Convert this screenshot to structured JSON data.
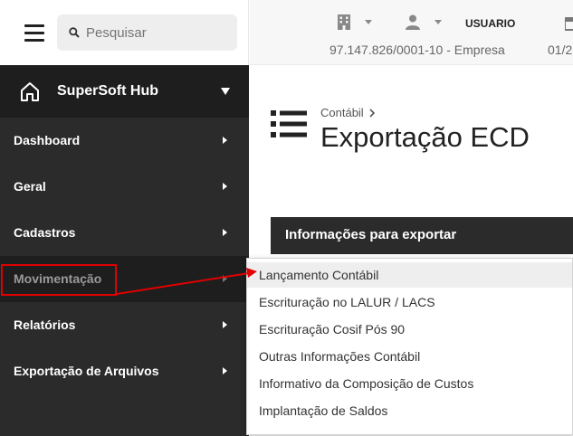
{
  "search": {
    "placeholder": "Pesquisar"
  },
  "header": {
    "user_label": "USUARIO",
    "company": "97.147.826/0001-10 - Empresa",
    "date_partial": "01/2"
  },
  "sidebar": {
    "hub_title": "SuperSoft Hub",
    "items": [
      {
        "label": "Dashboard"
      },
      {
        "label": "Geral"
      },
      {
        "label": "Cadastros"
      },
      {
        "label": "Movimentação"
      },
      {
        "label": "Relatórios"
      },
      {
        "label": "Exportação de Arquivos"
      }
    ]
  },
  "main": {
    "breadcrumb": "Contábil",
    "title": "Exportação ECD",
    "panel_header": "Informações para exportar"
  },
  "submenu": {
    "items": [
      {
        "label": "Lançamento Contábil"
      },
      {
        "label": "Escrituração no LALUR / LACS"
      },
      {
        "label": "Escrituração Cosif Pós 90"
      },
      {
        "label": "Outras Informações Contábil"
      },
      {
        "label": "Informativo da Composição de Custos"
      },
      {
        "label": "Implantação de Saldos"
      }
    ]
  },
  "colors": {
    "sidebar_bg": "#2b2b2b",
    "sidebar_active_bg": "#1e1e1e",
    "annotation_red": "#e00000"
  },
  "icons": [
    "menu-icon",
    "search-icon",
    "building-icon",
    "person-icon",
    "calendar-icon",
    "home-icon",
    "list-icon"
  ]
}
